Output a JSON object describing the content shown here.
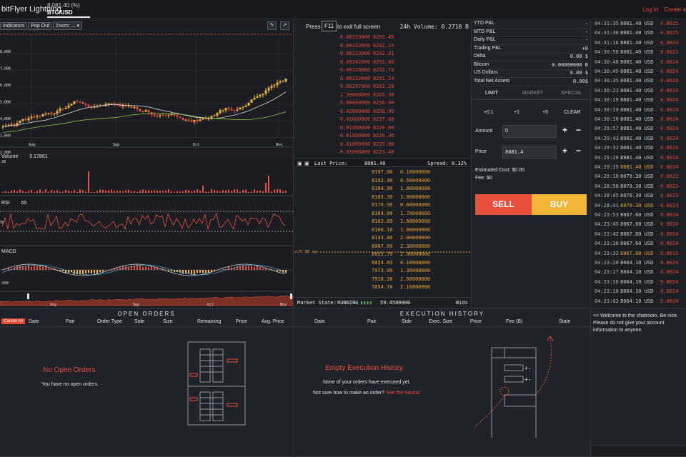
{
  "app": {
    "brand": "bitFlyer Lightning",
    "ticker_price": "8,081.40 (%)",
    "ticker_symbol": "BTC/USD",
    "login": "Log In",
    "create": "Create a"
  },
  "chart": {
    "toolbar": [
      "Indicators",
      "Pop Out",
      "Zoom:"
    ],
    "zoom_value": "...",
    "price_ticks": [
      "8,000",
      "7,000",
      "6,000",
      "5,000",
      "4,000",
      "3,000",
      "2,000"
    ],
    "months": [
      "Aug",
      "Sep",
      "Oct",
      "Nov"
    ],
    "volume_label": "Volume",
    "volume_value": "0.17861",
    "rsi_label": "RSI",
    "rsi_value": "65",
    "rsi_tick": "50",
    "macd_label": "MACD",
    "macd_tick": "-500",
    "nav_months": [
      "Aug",
      "Sep",
      "Oct",
      "Nov"
    ]
  },
  "book": {
    "press": "Press",
    "key": "F11",
    "press_tail": "to exit full screen",
    "volume_label": "24h Volume:",
    "volume_value": "0.2718 B",
    "asks": [
      [
        "0.00233000",
        "8292.45"
      ],
      [
        "0.00233000",
        "8292.23"
      ],
      [
        "0.00233000",
        "8292.01"
      ],
      [
        "0.00242000",
        "8291.88"
      ],
      [
        "0.00226000",
        "8291.79"
      ],
      [
        "0.00232000",
        "8291.54"
      ],
      [
        "0.00297000",
        "8291.28"
      ],
      [
        "2.30000000",
        "8265.30"
      ],
      [
        "5.00000000",
        "8250.99"
      ],
      [
        "0.02000000",
        "8238.99"
      ],
      [
        "0.01000000",
        "8237.60"
      ],
      [
        "0.01000000",
        "8226.60"
      ],
      [
        "0.01000000",
        "8226.36"
      ],
      [
        "0.01000000",
        "8225.00"
      ],
      [
        "0.01000000",
        "8223.40"
      ]
    ],
    "last_label": "Last Price:",
    "last_value": "8081.40",
    "spread_label": "Spread:",
    "spread_value": "0.32%",
    "bids": [
      [
        "8197.00",
        "0.10000000"
      ],
      [
        "8192.40",
        "0.50000000"
      ],
      [
        "8184.90",
        "1.00000000"
      ],
      [
        "8183.39",
        "1.00000000"
      ],
      [
        "8179.90",
        "0.60000000"
      ],
      [
        "8164.00",
        "1.70000000"
      ],
      [
        "8162.89",
        "1.60000000"
      ],
      [
        "8160.10",
        "1.60000000"
      ],
      [
        "8133.80",
        "2.00000000"
      ],
      [
        "8087.69",
        "2.30000000"
      ],
      [
        "8055.79",
        "2.90000000"
      ],
      [
        "8024.83",
        "0.10000000"
      ],
      [
        "7973.90",
        "1.30000000"
      ],
      [
        "7918.20",
        "2.60000000"
      ],
      [
        "7854.70",
        "2.10000000"
      ]
    ],
    "depth_marker": "LTC BB ago",
    "market_state_label": "Market State:",
    "market_state": "RUNNING",
    "total_value": "59.4500000",
    "bids_label": "Bids"
  },
  "account": {
    "rows": [
      [
        "YTD P&L",
        "-"
      ],
      [
        "MTD P&L",
        "-"
      ],
      [
        "Daily P&L",
        "-"
      ],
      [
        "Trading P&L",
        "+0"
      ],
      [
        "Delta",
        "0.00 $"
      ],
      [
        "Bitcoin",
        "0.00000000 B"
      ],
      [
        "US Dollars",
        "0.00 $"
      ],
      [
        "Total Net Assets",
        "0.00$"
      ]
    ],
    "tabs": [
      "LIMIT",
      "MARKET",
      "SPECIAL"
    ],
    "quick": [
      "+0.1",
      "+1",
      "+5",
      "CLEAR"
    ],
    "amount_label": "Amount",
    "amount_value": "0",
    "price_label": "Price",
    "price_value": "8081.4",
    "est_cost": "Estimated Cost: $0.00",
    "fee": "Fee: $0",
    "sell": "SELL",
    "buy": "BUY"
  },
  "trades": [
    [
      "04:31:35",
      "8081.40 USD",
      "0.0025"
    ],
    [
      "04:31:30",
      "8081.40 USD",
      "0.0025"
    ],
    [
      "04:31:16",
      "8081.40 USD",
      "0.0023"
    ],
    [
      "04:30:58",
      "8081.40 USD",
      "0.0021"
    ],
    [
      "04:30:48",
      "8081.40 USD",
      "0.0024"
    ],
    [
      "04:30:45",
      "8081.40 USD",
      "0.0024"
    ],
    [
      "04:30:35",
      "8081.40 USD",
      "0.0024"
    ],
    [
      "04:30:22",
      "8081.40 USD",
      "0.0024"
    ],
    [
      "04:30:19",
      "8081.40 USD",
      "0.0024"
    ],
    [
      "04:30:19",
      "8081.40 USD",
      "0.0024"
    ],
    [
      "04:30:10",
      "8081.40 USD",
      "0.0024"
    ],
    [
      "04:29:57",
      "8081.40 USD",
      "0.0024"
    ],
    [
      "04:29:43",
      "8081.40 USD",
      "0.0024"
    ],
    [
      "04:29:32",
      "8081.40 USD",
      "0.0024"
    ],
    [
      "04:29:20",
      "8081.40 USD",
      "0.0024"
    ],
    [
      "04:29:15",
      "8081.40 USD",
      "0.0024"
    ],
    [
      "04:29:10",
      "8079.30 USD",
      "0.0022"
    ],
    [
      "04:28:58",
      "8079.30 USD",
      "0.0023"
    ],
    [
      "04:28:45",
      "8079.30 USD",
      "0.0023"
    ],
    [
      "04:28:41",
      "8079.39 USD",
      "0.0023"
    ],
    [
      "04:23:53",
      "8067.60 USD",
      "0.0024"
    ],
    [
      "04:23:45",
      "8067.60 USD",
      "0.0024"
    ],
    [
      "04:23:42",
      "8067.60 USD",
      "0.0024"
    ],
    [
      "04:23:38",
      "8067.60 USD",
      "0.0024"
    ],
    [
      "04:23:32",
      "8067.60 USD",
      "0.0015"
    ],
    [
      "04:23:20",
      "8064.10 USD",
      "0.0024"
    ],
    [
      "04:23:17",
      "8064.10 USD",
      "0.0024"
    ],
    [
      "04:23:16",
      "8064.10 USD",
      "0.0024"
    ],
    [
      "04:23:10",
      "8064.10 USD",
      "0.0024"
    ],
    [
      "04:23:02",
      "8064.10 USD",
      "0.0024"
    ]
  ],
  "highlight_rows": [
    15,
    19,
    24
  ],
  "orders": {
    "title": "OPEN ORDERS",
    "cancel_all": "Cancel All",
    "cols": [
      "Date",
      "Pair",
      "Order Type",
      "Side",
      "Size",
      "Remaining",
      "Price",
      "Avg. Price"
    ],
    "empty_title": "No Open Orders",
    "empty_sub": "You have no open orders."
  },
  "exec": {
    "title": "EXECUTION HISTORY",
    "cols": [
      "Date",
      "Pair",
      "Side",
      "Exec. Size",
      "Price",
      "Fee (B)",
      "State"
    ],
    "empty_title": "Empty Execution History",
    "empty_sub": "None of your orders have executed yet.",
    "help_pre": "Not sure how to make an order?",
    "help_link": "See the tutorial."
  },
  "chat": {
    "message": "<< Welcome to the chatroom. Be nice. Please do not give your account information to anyone."
  },
  "colors": {
    "up": "#f2b636",
    "down": "#e9503b",
    "accent": "#e34a34"
  }
}
